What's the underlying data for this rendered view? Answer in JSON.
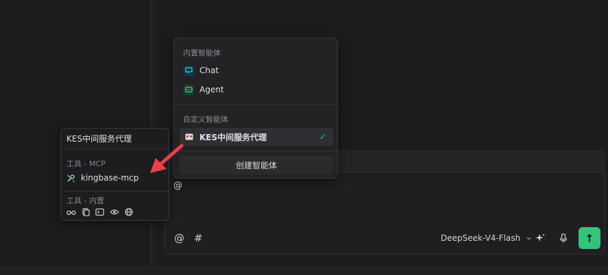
{
  "dropdown": {
    "builtin_section": "内置智能体",
    "builtin": [
      {
        "label": "Chat",
        "icon": "chat-agent-icon"
      },
      {
        "label": "Agent",
        "icon": "agent-icon"
      }
    ],
    "custom_section": "自定义智能体",
    "custom": [
      {
        "label": "KES中间服务代理",
        "icon": "kes-agent-icon",
        "selected": true
      }
    ],
    "check_mark": "✓",
    "create_label": "创建智能体"
  },
  "tooltip": {
    "title": "KES中间服务代理",
    "mcp_section": "工具 - MCP",
    "mcp_tool": "kingbase-mcp",
    "builtin_section": "工具 - 内置",
    "builtin_tool_icons": [
      "glasses-icon",
      "document-icon",
      "terminal-icon",
      "eye-icon",
      "globe-icon"
    ]
  },
  "input": {
    "text": "@",
    "mention_symbol": "@",
    "hash_symbol": "#",
    "model": "DeepSeek-V4-Flash",
    "send_symbol": "↑"
  },
  "colors": {
    "accent_green": "#35c27a",
    "arrow_red": "#e8404a"
  }
}
